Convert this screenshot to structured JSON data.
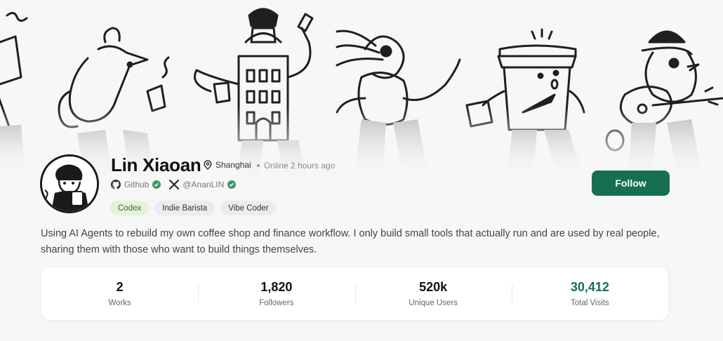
{
  "profile": {
    "name": "Lin Xiaoan",
    "location": "Shanghai",
    "online_status": "Online 2 hours ago",
    "follow_label": "Follow",
    "bio": "Using AI Agents to rebuild my own coffee shop and finance workflow. I only build small tools that actually run and are used by real people, sharing them with those who want to build things themselves."
  },
  "socials": [
    {
      "label": "Github",
      "icon": "github-icon",
      "verified": true
    },
    {
      "label": "@AnanLIN",
      "icon": "x-icon",
      "verified": true
    }
  ],
  "tags": [
    "Codex",
    "Indie Barista",
    "Vibe Coder"
  ],
  "stats": [
    {
      "value": "2",
      "label": "Works"
    },
    {
      "value": "1,820",
      "label": "Followers"
    },
    {
      "value": "520k",
      "label": "Unique Users"
    },
    {
      "value": "30,412",
      "label": "Total Visits"
    }
  ],
  "colors": {
    "accent": "#176f53",
    "tag_active_bg": "#e3f4d6",
    "verified": "#3c9a6a"
  }
}
